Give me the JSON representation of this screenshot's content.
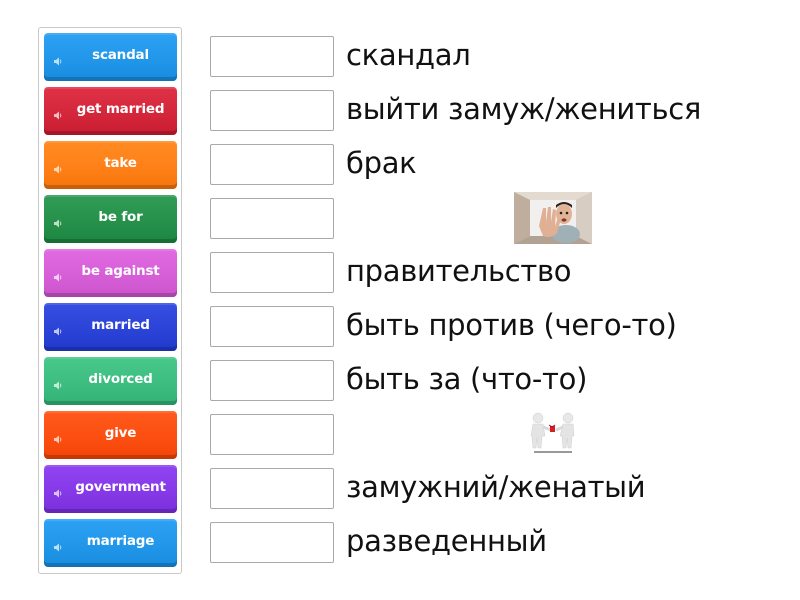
{
  "activity": "match-up",
  "tiles": [
    {
      "label": "scandal",
      "color": "#2196e8",
      "icon": "speaker-icon"
    },
    {
      "label": "get married",
      "color": "#d3263a",
      "icon": "speaker-icon"
    },
    {
      "label": "take",
      "color": "#ff7f17",
      "icon": "speaker-icon"
    },
    {
      "label": "be for",
      "color": "#25904a",
      "icon": "speaker-icon"
    },
    {
      "label": "be against",
      "color": "#d55ed6",
      "icon": "speaker-icon"
    },
    {
      "label": "married",
      "color": "#2a43d6",
      "icon": "speaker-icon"
    },
    {
      "label": "divorced",
      "color": "#3cbc7f",
      "icon": "speaker-icon"
    },
    {
      "label": "give",
      "color": "#fb4e10",
      "icon": "speaker-icon"
    },
    {
      "label": "government",
      "color": "#8438e6",
      "icon": "speaker-icon"
    },
    {
      "label": "marriage",
      "color": "#2196e8",
      "icon": "speaker-icon"
    }
  ],
  "answers": [
    {
      "type": "text",
      "text": "скандал"
    },
    {
      "type": "text",
      "text": "выйти замуж/жениться"
    },
    {
      "type": "text",
      "text": "брак"
    },
    {
      "type": "image",
      "image": "man-reaching-out-of-box-photo"
    },
    {
      "type": "text",
      "text": "правительство"
    },
    {
      "type": "text",
      "text": "быть против (чего-то)"
    },
    {
      "type": "text",
      "text": "быть за (что-то)"
    },
    {
      "type": "image",
      "image": "two-figures-giving-gift-illustration"
    },
    {
      "type": "text",
      "text": "замужний/женатый"
    },
    {
      "type": "text",
      "text": "разведенный"
    }
  ]
}
